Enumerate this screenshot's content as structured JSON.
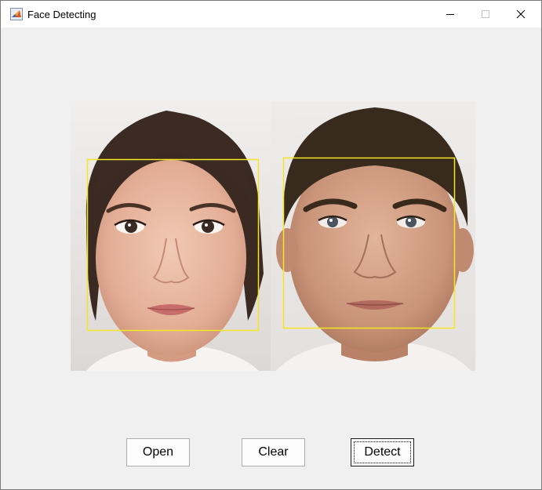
{
  "window": {
    "title": "Face Detecting",
    "icon": "matlab-icon",
    "controls": [
      "minimize-icon",
      "maximize-icon",
      "close-icon"
    ]
  },
  "image": {
    "content": "two-face-photos",
    "detection_box_color": "#f5e623",
    "detected_faces": 2
  },
  "buttons": {
    "open_label": "Open",
    "clear_label": "Clear",
    "detect_label": "Detect"
  },
  "colors": {
    "window_bg": "#f0f0f0",
    "titlebar_bg": "#ffffff",
    "button_bg": "#fdfdfd",
    "button_border": "#adadad"
  }
}
